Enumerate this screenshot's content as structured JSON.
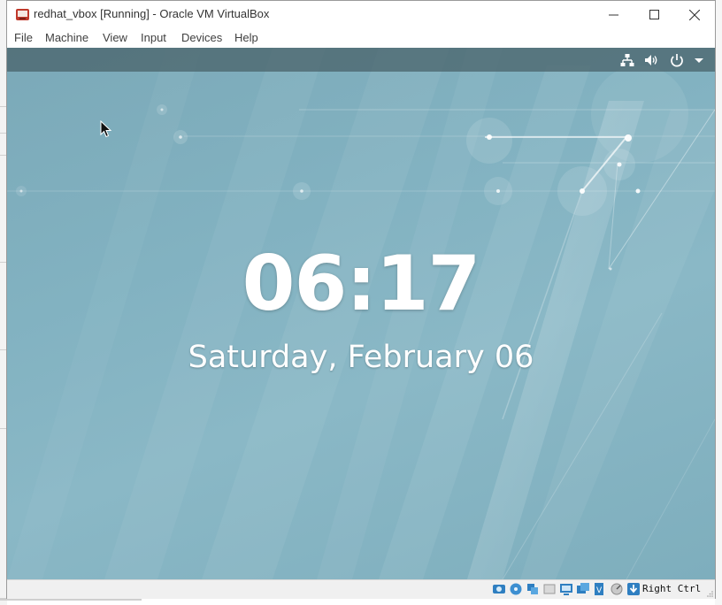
{
  "window": {
    "title": "redhat_vbox [Running] - Oracle VM VirtualBox",
    "controls": [
      "minimize-icon",
      "maximize-icon",
      "close-icon"
    ]
  },
  "menu": {
    "items": [
      {
        "label": "File"
      },
      {
        "label": "Machine"
      },
      {
        "label": "View"
      },
      {
        "label": "Input"
      },
      {
        "label": "Devices"
      },
      {
        "label": "Help"
      }
    ]
  },
  "guest": {
    "topbar_icons": [
      "network-icon",
      "volume-icon",
      "power-icon",
      "chevron-down-icon"
    ],
    "lock_screen": {
      "time": "06:17",
      "date": "Saturday, February 06"
    }
  },
  "statusbar": {
    "icons": [
      "hard-disk-icon",
      "optical-drive-icon",
      "audio-icon",
      "network-adapter-icon",
      "usb-icon",
      "shared-folders-icon",
      "display-icon",
      "video-capture-icon",
      "cpu-icon",
      "mouse-integration-icon",
      "host-key-icon"
    ],
    "host_key": "Right Ctrl"
  },
  "colors": {
    "screen_bg": "#82b2c1",
    "topbar_bg": "#4f6b72",
    "text_white": "#ffffff"
  }
}
